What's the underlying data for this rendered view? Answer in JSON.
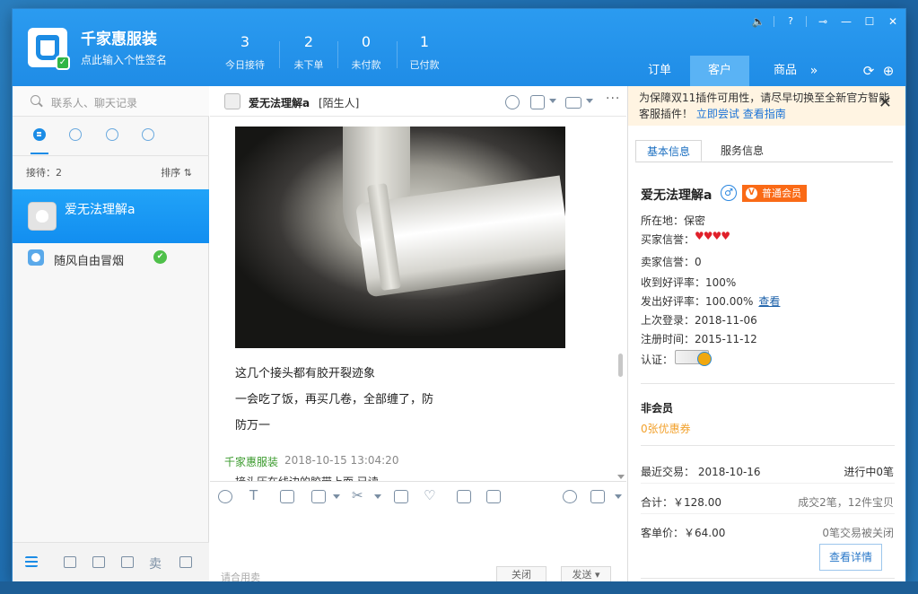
{
  "header": {
    "shop_name": "千家惠服装",
    "signature": "点此输入个性签名",
    "stats": [
      {
        "num": "3",
        "label": "今日接待"
      },
      {
        "num": "2",
        "label": "未下单"
      },
      {
        "num": "0",
        "label": "未付款"
      },
      {
        "num": "1",
        "label": "已付款"
      }
    ],
    "nav_tabs": [
      "订单",
      "客户",
      "商品"
    ],
    "nav_more": "»",
    "active_tab": "客户",
    "controls": {
      "sound": "🔈",
      "help": "?",
      "pin": "⊸",
      "min": "—",
      "max": "☐",
      "close": "✕"
    }
  },
  "left": {
    "search_placeholder": "联系人、聊天记录",
    "count_label": "接待：2",
    "sort_label": "排序 ⇅",
    "contacts": [
      {
        "name": "爱无法理解a",
        "active": true
      },
      {
        "name": "随风自由冒烟",
        "active": false,
        "online": "✔"
      }
    ],
    "footer": {
      "sell": "卖"
    }
  },
  "chat": {
    "name": "爱无法理解a",
    "tag": "[陌生人]",
    "more": "···",
    "messages": [
      "这几个接头都有胶开裂迹象",
      "一会吃了饭，再买几卷，全部缠了，防",
      "防万一"
    ],
    "sender": "千家惠服装",
    "time": "2018-10-15 13:04:20",
    "truncated": "接头压在线边的胶带上面 已读",
    "input_hint": "请合用卖",
    "btn_close": "关闭",
    "btn_send": "发送 ▾",
    "toolbar_text": "T"
  },
  "right": {
    "notice_text": "为保障双11插件可用性，请尽早切换至全新官方智能客服插件！",
    "notice_link1": "立即尝试",
    "notice_link2": "查看指南",
    "notice_close": "✕",
    "tabs": [
      "基本信息",
      "服务信息"
    ],
    "user": {
      "name": "爱无法理解a",
      "gender": "♂",
      "level": "普通会员",
      "location": "所在地：保密",
      "buyer_credit_label": "买家信誉：",
      "buyer_credit": "♥♥♥♥",
      "seller_credit": "卖家信誉：0",
      "good_rate": "收到好评率：100%",
      "given_rate": "发出好评率：100.00%",
      "view": "查看",
      "last_login": "上次登录：2018-11-06",
      "registered": "注册时间：2015-11-12",
      "cert_label": "认证："
    },
    "member": {
      "title": "非会员",
      "coupon": "0张优惠券"
    },
    "trade": {
      "recent": "最近交易： 2018-10-16",
      "ongoing": "进行中0笔",
      "total": "合计：￥128.00",
      "count": "成交2笔，12件宝贝",
      "avg": "客单价：￥64.00",
      "closed": "0笔交易被关闭",
      "detail_btn": "查看详情"
    }
  }
}
